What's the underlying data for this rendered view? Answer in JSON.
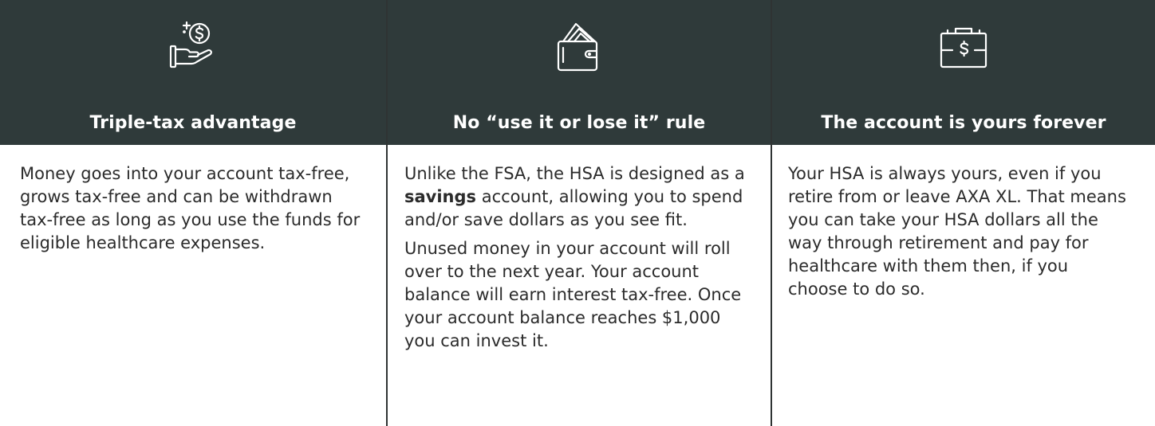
{
  "columns": [
    {
      "icon": "hand-dollar-coin-icon",
      "title": "Triple-tax advantage",
      "paragraphs": [
        "Money goes into your account tax-free, grows tax-free and can be withdrawn tax-free as long as you use the funds for eligible healthcare expenses."
      ]
    },
    {
      "icon": "wallet-icon",
      "title": "No “use it or lose it” rule",
      "p1_before": "Unlike the FSA, the HSA is designed as a ",
      "p1_bold": "savings",
      "p1_after": " account, allowing you to spend and/or save dollars as you see fit.",
      "p2": "Unused money in your account will roll over to the next year. Your account balance will earn interest tax-free. Once your account balance reaches $1,000 you can invest it."
    },
    {
      "icon": "briefcase-dollar-icon",
      "title": "The account is yours forever",
      "paragraphs": [
        "Your HSA is always yours, even if you retire from or leave AXA XL. That means you can take your HSA dollars all the way through retirement and pay for healthcare with them then, if you choose to do so."
      ]
    }
  ],
  "colors": {
    "header_bg": "#2f3a3a",
    "header_text": "#ffffff",
    "body_text": "#2b2b2b",
    "divider": "#2f3333"
  }
}
